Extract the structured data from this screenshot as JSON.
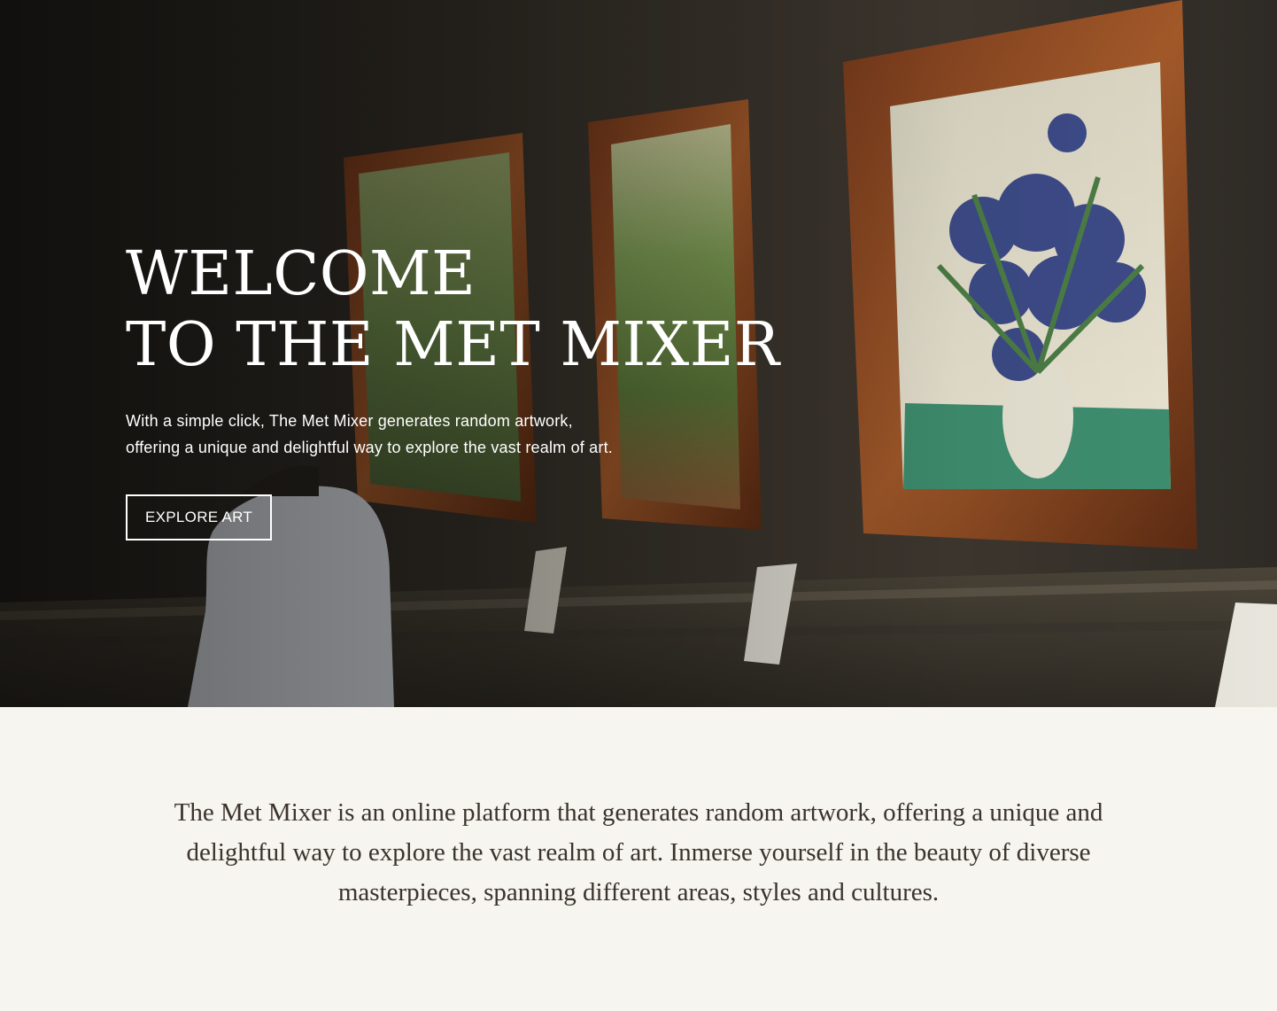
{
  "hero": {
    "title_line1": "WELCOME",
    "title_line2": "TO THE MET MIXER",
    "subtitle_line1": "With a simple click, The Met Mixer generates random artwork,",
    "subtitle_line2": "offering a unique and delightful way to explore the vast realm of art.",
    "cta_label": "EXPLORE ART",
    "background_image": "museum-gallery-photo"
  },
  "about": {
    "text": "The Met Mixer is an online platform that generates random artwork, offering a unique and delightful way to explore the vast realm of art. Inmerse yourself in the beauty of diverse masterpieces, spanning different areas, styles and cultures."
  },
  "colors": {
    "hero_text": "#ffffff",
    "about_background": "#f6f5f0",
    "about_text": "#3b332c"
  }
}
